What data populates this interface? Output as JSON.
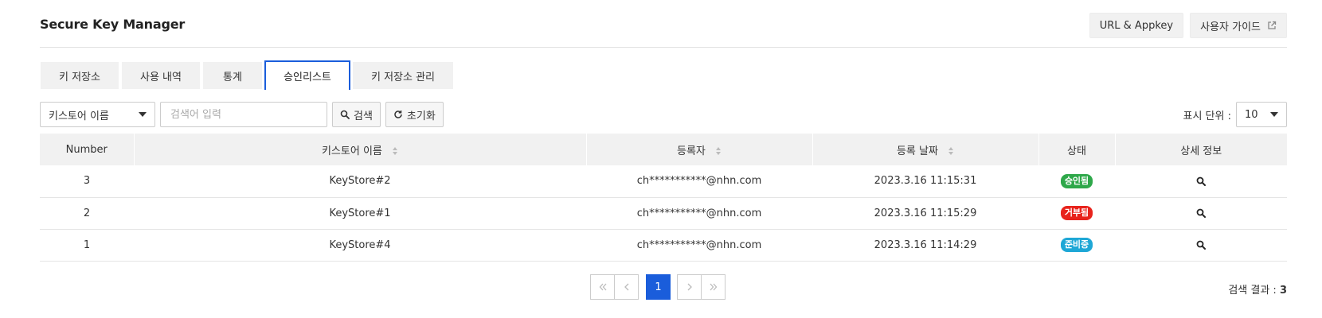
{
  "header": {
    "title": "Secure Key Manager",
    "url_appkey_button": "URL & Appkey",
    "user_guide_button": "사용자 가이드"
  },
  "tabs": [
    {
      "label": "키 저장소",
      "active": false
    },
    {
      "label": "사용 내역",
      "active": false
    },
    {
      "label": "통계",
      "active": false
    },
    {
      "label": "승인리스트",
      "active": true
    },
    {
      "label": "키 저장소 관리",
      "active": false
    }
  ],
  "filter": {
    "field_select": "키스토어 이름",
    "search_placeholder": "검색어 입력",
    "search_button": "검색",
    "reset_button": "초기화"
  },
  "page_size": {
    "label": "표시 단위 :",
    "value": "10"
  },
  "table": {
    "columns": [
      "Number",
      "키스토어 이름",
      "등록자",
      "등록 날짜",
      "상태",
      "상세 정보"
    ],
    "rows": [
      {
        "number": "3",
        "keystore": "KeyStore#2",
        "registrant": "ch***********@nhn.com",
        "date": "2023.3.16 11:15:31",
        "status": "승인됨",
        "status_color": "#2ea84a"
      },
      {
        "number": "2",
        "keystore": "KeyStore#1",
        "registrant": "ch***********@nhn.com",
        "date": "2023.3.16 11:15:29",
        "status": "거부됨",
        "status_color": "#e8231c"
      },
      {
        "number": "1",
        "keystore": "KeyStore#4",
        "registrant": "ch***********@nhn.com",
        "date": "2023.3.16 11:14:29",
        "status": "준비중",
        "status_color": "#1ea7d6"
      }
    ]
  },
  "pagination": {
    "current_page": "1"
  },
  "result": {
    "label": "검색 결과 :",
    "count": "3"
  },
  "colors": {
    "accent": "#1a5ddb",
    "header_bg": "#f1f1f1"
  }
}
